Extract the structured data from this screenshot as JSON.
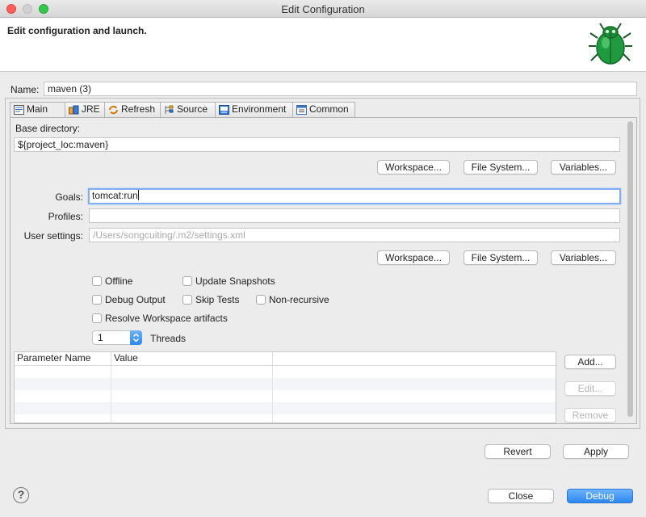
{
  "window": {
    "title": "Edit Configuration"
  },
  "banner": {
    "title": "Edit configuration and launch."
  },
  "name": {
    "label": "Name:",
    "value": "maven (3)"
  },
  "tabs": [
    {
      "label": "Main",
      "icon": "main-tab-icon"
    },
    {
      "label": "JRE",
      "icon": "jre-icon"
    },
    {
      "label": "Refresh",
      "icon": "refresh-icon"
    },
    {
      "label": "Source",
      "icon": "source-icon"
    },
    {
      "label": "Environment",
      "icon": "environment-icon"
    },
    {
      "label": "Common",
      "icon": "common-icon"
    }
  ],
  "main": {
    "base_dir_label": "Base directory:",
    "base_dir_value": "${project_loc:maven}",
    "workspace_btn": "Workspace...",
    "filesystem_btn": "File System...",
    "variables_btn": "Variables...",
    "goals_label": "Goals:",
    "goals_value": "tomcat:run",
    "profiles_label": "Profiles:",
    "profiles_value": "",
    "user_settings_label": "User settings:",
    "user_settings_placeholder": "/Users/songcuiting/.m2/settings.xml",
    "workspace_btn2": "Workspace...",
    "filesystem_btn2": "File System...",
    "variables_btn2": "Variables...",
    "checkboxes": {
      "offline": "Offline",
      "update_snapshots": "Update Snapshots",
      "debug_output": "Debug Output",
      "skip_tests": "Skip Tests",
      "non_recursive": "Non-recursive",
      "resolve_workspace": "Resolve Workspace artifacts"
    },
    "threads_value": "1",
    "threads_label": "Threads",
    "params": {
      "col_name": "Parameter Name",
      "col_value": "Value"
    },
    "add_btn": "Add...",
    "edit_btn": "Edit...",
    "remove_btn": "Remove"
  },
  "footer": {
    "revert": "Revert",
    "apply": "Apply",
    "close": "Close",
    "debug": "Debug",
    "help": "?"
  },
  "colors": {
    "accent": "#2c87f0",
    "focus": "#7eadf5"
  }
}
